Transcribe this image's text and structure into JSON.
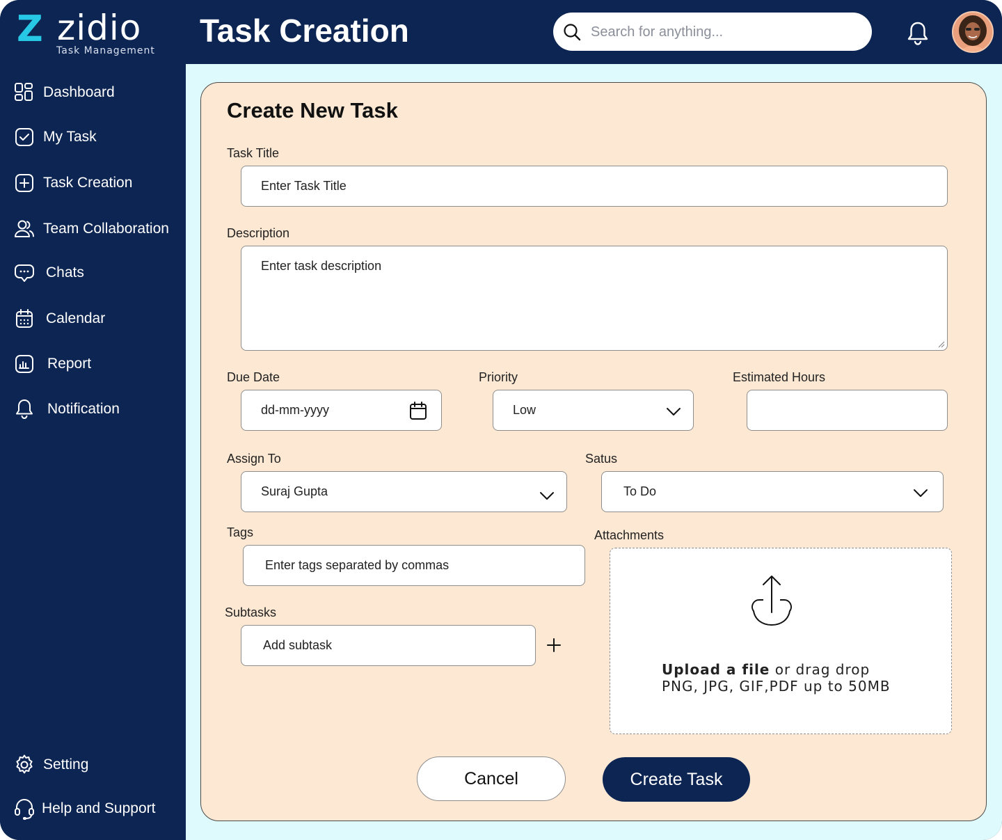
{
  "brand": {
    "logo_letter": "Z",
    "name": "zidio",
    "tagline": "Task Management"
  },
  "header": {
    "title": "Task Creation",
    "search_placeholder": "Search for anything..."
  },
  "sidebar": {
    "items": [
      {
        "label": "Dashboard",
        "icon": "grid-icon"
      },
      {
        "label": "My Task",
        "icon": "checkbox-icon"
      },
      {
        "label": "Task Creation",
        "icon": "plus-square-icon"
      },
      {
        "label": "Team Collaboration",
        "icon": "users-icon"
      },
      {
        "label": "Chats",
        "icon": "chat-icon"
      },
      {
        "label": "Calendar",
        "icon": "calendar-icon"
      },
      {
        "label": "Report",
        "icon": "bar-chart-icon"
      },
      {
        "label": "Notification",
        "icon": "bell-icon"
      }
    ],
    "bottom_items": [
      {
        "label": "Setting",
        "icon": "gear-icon"
      },
      {
        "label": "Help and Support",
        "icon": "headset-icon"
      }
    ]
  },
  "form": {
    "title": "Create New Task",
    "task_title_label": "Task Title",
    "task_title_placeholder": "Enter Task Title",
    "description_label": "Description",
    "description_placeholder": "Enter task description",
    "due_date_label": "Due Date",
    "due_date_placeholder": "dd-mm-yyyy",
    "priority_label": "Priority",
    "priority_value": "Low",
    "estimated_hours_label": "Estimated Hours",
    "estimated_hours_value": "",
    "assign_to_label": "Assign To",
    "assign_to_value": "Suraj Gupta",
    "status_label": "Satus",
    "status_value": "To Do",
    "tags_label": "Tags",
    "tags_placeholder": "Enter tags separated by commas",
    "attachments_label": "Attachments",
    "upload_link": "Upload a file",
    "upload_rest": " or drag drop",
    "upload_formats": "PNG, JPG, GIF,PDF up to 50MB",
    "subtasks_label": "Subtasks",
    "subtask_placeholder": "Add subtask",
    "cancel_label": "Cancel",
    "create_label": "Create Task"
  },
  "colors": {
    "navy": "#0d2553",
    "accent": "#27c7e6",
    "card": "#fde8d3",
    "main_bg": "#dffafd"
  }
}
